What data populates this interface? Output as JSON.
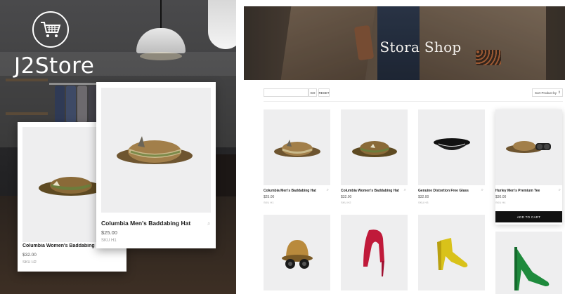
{
  "brand": {
    "name": "J2Store",
    "icon": "shopping-cart-icon"
  },
  "promo_cards": [
    {
      "name": "Columbia Women's Baddabing Hat",
      "price": "$32.00",
      "sku": "SKU H2"
    },
    {
      "name": "Columbia Men's Baddabing Hat",
      "price": "$25.00",
      "sku": "SKU H1"
    }
  ],
  "shop": {
    "title": "Stora Shop",
    "search": {
      "value": "",
      "placeholder": ""
    },
    "go_label": "GO",
    "reset_label": "RESET",
    "sort": {
      "selected": "Sort Product by"
    },
    "add_to_cart_label": "ADD TO CART"
  },
  "products": [
    {
      "name": "Columbia Men's Baddabing Hat",
      "price": "$25.00",
      "sku": "SKU H1"
    },
    {
      "name": "Columbia Women's Baddabing Hat",
      "price": "$32.00",
      "sku": "SKU H2"
    },
    {
      "name": "Genuine Distortion Free Glass",
      "price": "$32.00",
      "sku": "SKU H3"
    },
    {
      "name": "Hurley Men's Premium Tee",
      "price": "$30.00",
      "sku": "SKU H4"
    }
  ],
  "colors": {
    "accent": "#111111",
    "card_bg": "#eeeeef"
  }
}
